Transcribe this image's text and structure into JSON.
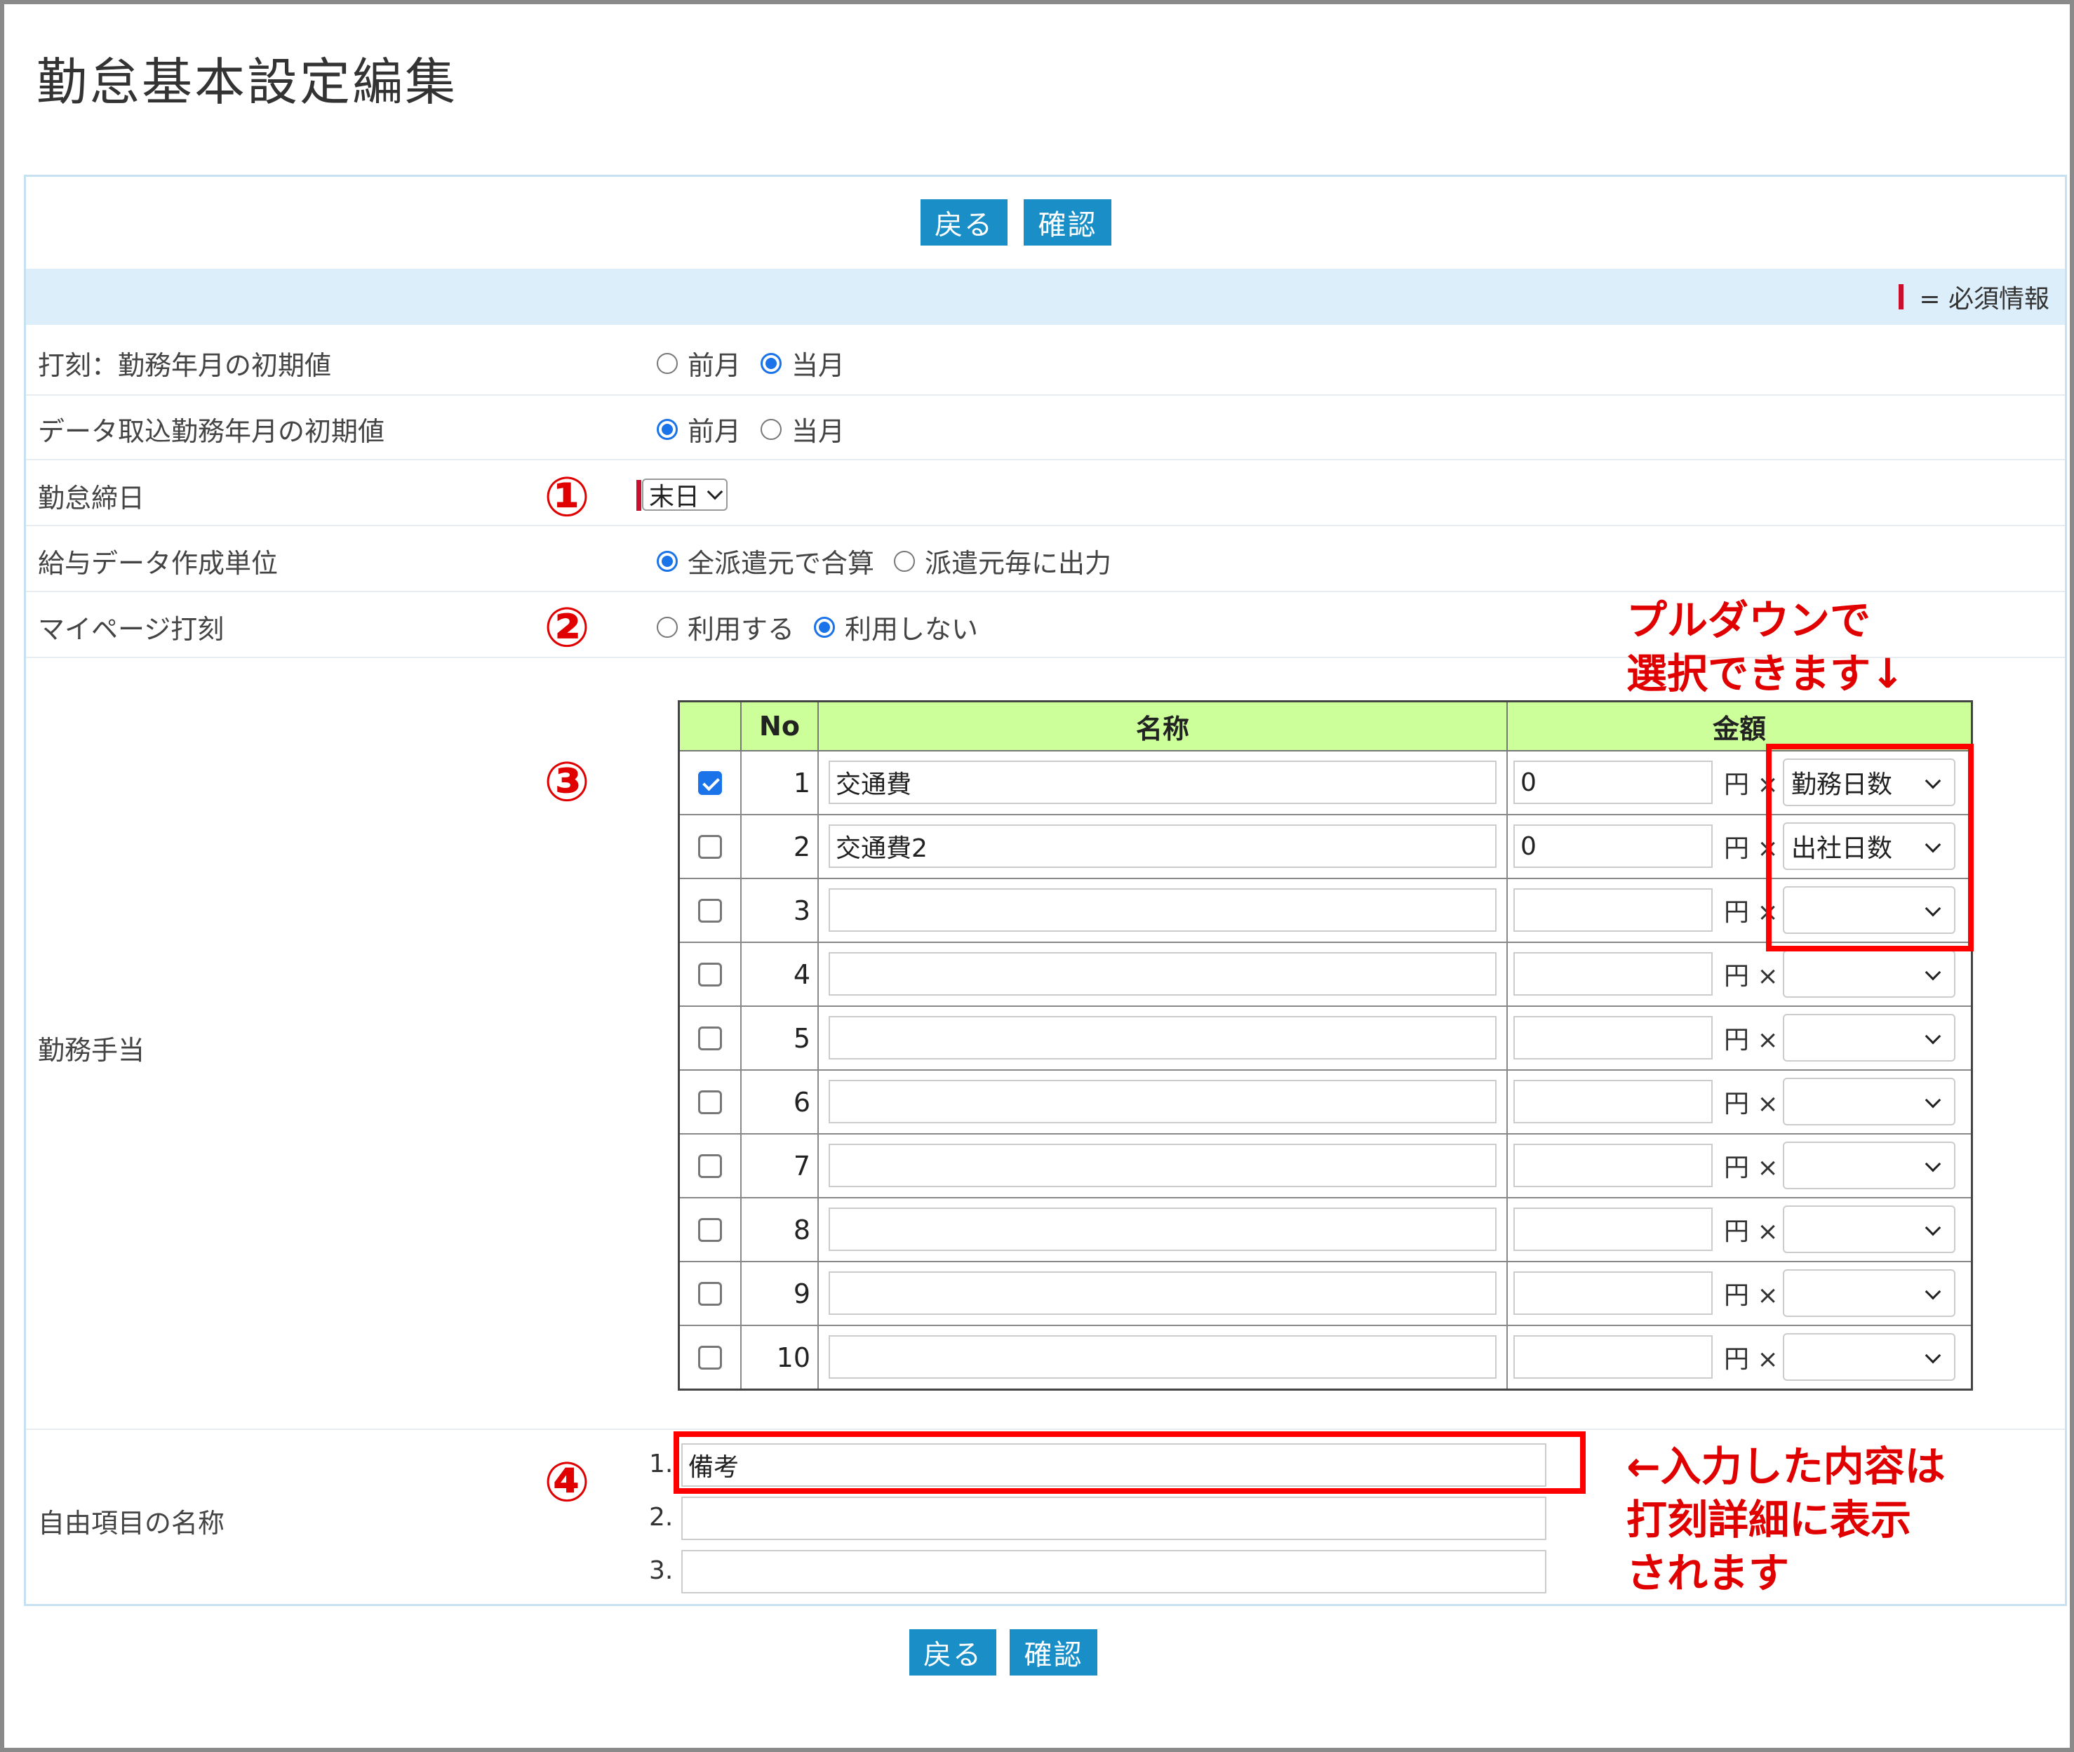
{
  "page": {
    "title": "勤怠基本設定編集"
  },
  "toolbar": {
    "back_label": "戻る",
    "confirm_label": "確認"
  },
  "required_info": {
    "label": "= 必須情報"
  },
  "rows": {
    "stamp_default": {
      "label": "打刻：勤務年月の初期値",
      "options": [
        "前月",
        "当月"
      ],
      "selected": "当月"
    },
    "import_default": {
      "label": "データ取込勤務年月の初期値",
      "options": [
        "前月",
        "当月"
      ],
      "selected": "前月"
    },
    "closing_day": {
      "label": "勤怠締日",
      "value": "末日"
    },
    "payroll_unit": {
      "label": "給与データ作成単位",
      "options": [
        "全派遣元で合算",
        "派遣元毎に出力"
      ],
      "selected": "全派遣元で合算"
    },
    "mypage_stamp": {
      "label": "マイページ打刻",
      "options": [
        "利用する",
        "利用しない"
      ],
      "selected": "利用しない"
    },
    "allowance": {
      "label": "勤務手当"
    },
    "free_items": {
      "label": "自由項目の名称"
    }
  },
  "allowance_table": {
    "headers": {
      "no": "No",
      "name": "名称",
      "amount": "金額"
    },
    "unit": "円 ×",
    "rows": [
      {
        "no": "1",
        "checked": true,
        "name": "交通費",
        "amount": "0",
        "basis": "勤務日数"
      },
      {
        "no": "2",
        "checked": false,
        "name": "交通費2",
        "amount": "0",
        "basis": "出社日数"
      },
      {
        "no": "3",
        "checked": false,
        "name": "",
        "amount": "",
        "basis": ""
      },
      {
        "no": "4",
        "checked": false,
        "name": "",
        "amount": "",
        "basis": ""
      },
      {
        "no": "5",
        "checked": false,
        "name": "",
        "amount": "",
        "basis": ""
      },
      {
        "no": "6",
        "checked": false,
        "name": "",
        "amount": "",
        "basis": ""
      },
      {
        "no": "7",
        "checked": false,
        "name": "",
        "amount": "",
        "basis": ""
      },
      {
        "no": "8",
        "checked": false,
        "name": "",
        "amount": "",
        "basis": ""
      },
      {
        "no": "9",
        "checked": false,
        "name": "",
        "amount": "",
        "basis": ""
      },
      {
        "no": "10",
        "checked": false,
        "name": "",
        "amount": "",
        "basis": ""
      }
    ]
  },
  "free_items": [
    {
      "num": "1.",
      "value": "備考"
    },
    {
      "num": "2.",
      "value": ""
    },
    {
      "num": "3.",
      "value": ""
    }
  ],
  "annotations": {
    "markers": [
      "①",
      "②",
      "③",
      "④"
    ],
    "pulldown_note": [
      "プルダウンで",
      "選択できます↓"
    ],
    "input_note": [
      "←入力した内容は",
      "打刻詳細に表示",
      "されます"
    ]
  },
  "colors": {
    "button": "#1a8fc7",
    "header_band": "#dceefa",
    "table_header": "#ccff99",
    "annotation_red": "#e00000"
  }
}
